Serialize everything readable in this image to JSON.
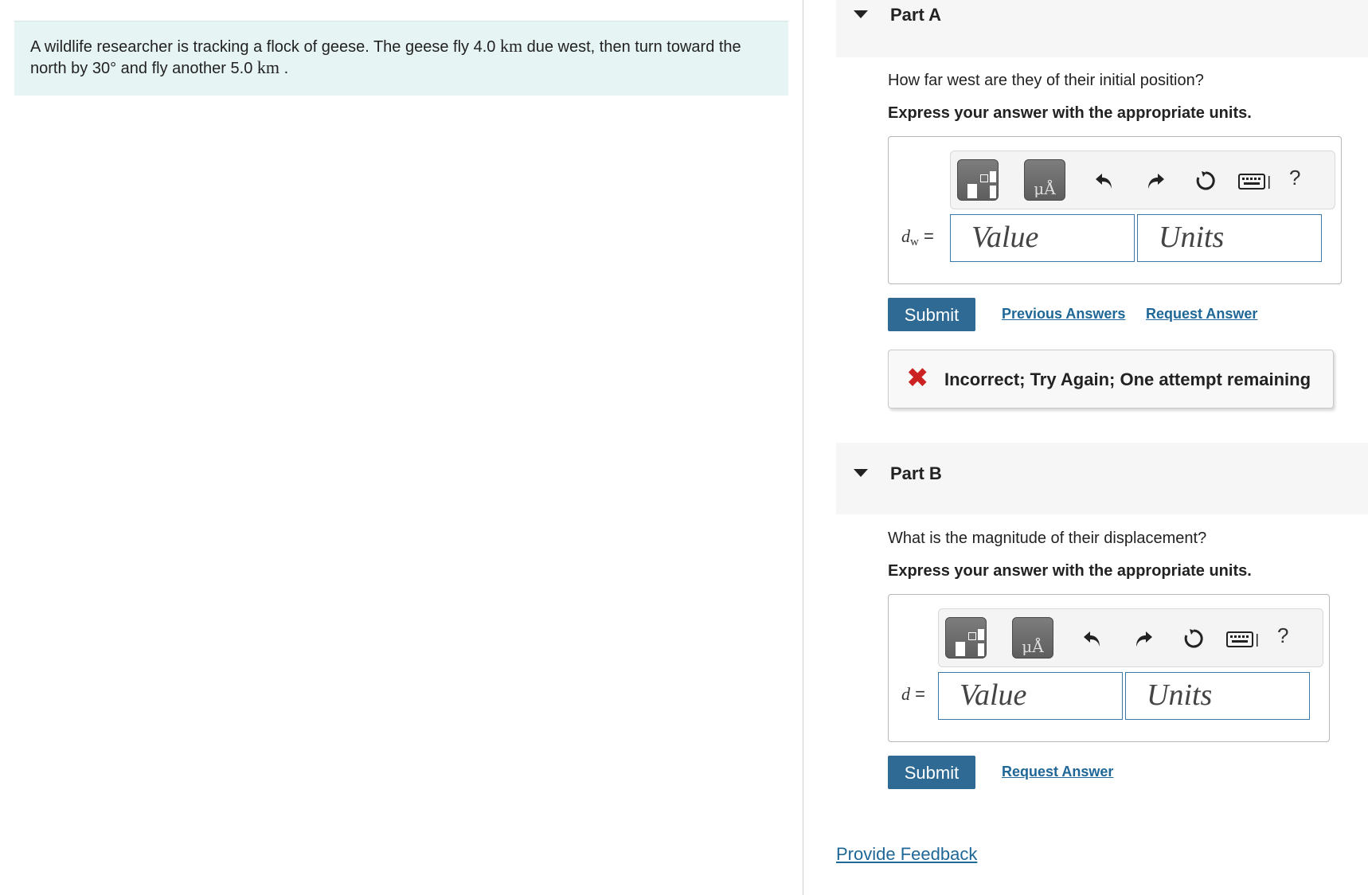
{
  "problem": {
    "text_1": "A wildlife researcher is tracking a flock of geese. The geese fly 4.0",
    "unit_1": "km",
    "text_2": "due west, then turn toward the north by 30",
    "degree": "°",
    "text_3": "and fly another 5.0",
    "unit_2": "km",
    "text_4": "."
  },
  "part_a": {
    "title": "Part A",
    "question": "How far west are they of their initial position?",
    "instruction": "Express your answer with the appropriate units.",
    "toolbar": {
      "units_button": "μÅ",
      "help": "?",
      "icons": [
        "templates-icon",
        "units-icon",
        "undo-icon",
        "redo-icon",
        "reset-icon",
        "keyboard-icon",
        "help-icon"
      ]
    },
    "variable": "d",
    "subscript": "w",
    "equals": "=",
    "value_placeholder": "Value",
    "units_placeholder": "Units",
    "submit_label": "Submit",
    "previous_answers_label": "Previous Answers",
    "request_answer_label": "Request Answer",
    "feedback_message": "Incorrect; Try Again; One attempt remaining",
    "feedback_color": "#cc2222"
  },
  "part_b": {
    "title": "Part B",
    "question": "What is the magnitude of their displacement?",
    "instruction": "Express your answer with the appropriate units.",
    "toolbar": {
      "units_button": "μÅ",
      "help": "?"
    },
    "variable": "d",
    "equals": "=",
    "value_placeholder": "Value",
    "units_placeholder": "Units",
    "submit_label": "Submit",
    "request_answer_label": "Request Answer"
  },
  "footer": {
    "provide_feedback_label": "Provide Feedback"
  },
  "colors": {
    "problem_background": "#e7f4f4",
    "submit_background": "#2e6a93",
    "link": "#1f6797",
    "input_border": "#3a78a8"
  }
}
